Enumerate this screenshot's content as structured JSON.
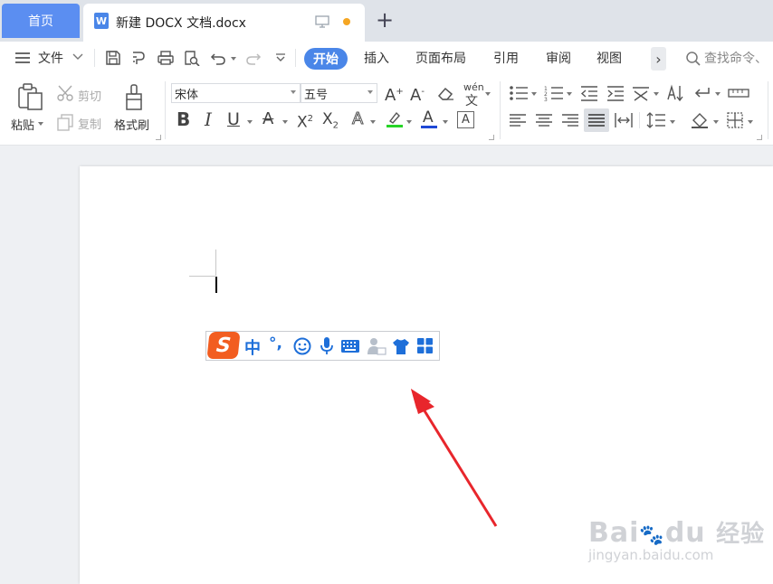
{
  "tabs": {
    "home_label": "首页",
    "document_name": "新建 DOCX 文档.docx",
    "doc_icon_letter": "W",
    "new_tab_symbol": "+"
  },
  "menu": {
    "file_label": "文件",
    "tabs": [
      "开始",
      "插入",
      "页面布局",
      "引用",
      "审阅",
      "视图"
    ],
    "more_symbol": "›",
    "search_placeholder": "查找命令、"
  },
  "ribbon": {
    "paste_label": "粘贴",
    "cut_label": "剪切",
    "copy_label": "复制",
    "format_painter_label": "格式刷",
    "font_name": "宋体",
    "font_size": "五号",
    "phonetic_label": "wén"
  },
  "ime_toolbar": {
    "logo_letter": "S",
    "mode_label": "中",
    "punct_label": "°,"
  },
  "watermark": {
    "brand": "Bai",
    "brand_tail": "du",
    "brand_cn": "经验",
    "url": "jingyan.baidu.com"
  },
  "colors": {
    "accent": "#4a86e8",
    "home_tab": "#5b8ef1",
    "arrow": "#e8262c",
    "sogou": "#f25d20",
    "ime_blue": "#1e6fd9"
  }
}
